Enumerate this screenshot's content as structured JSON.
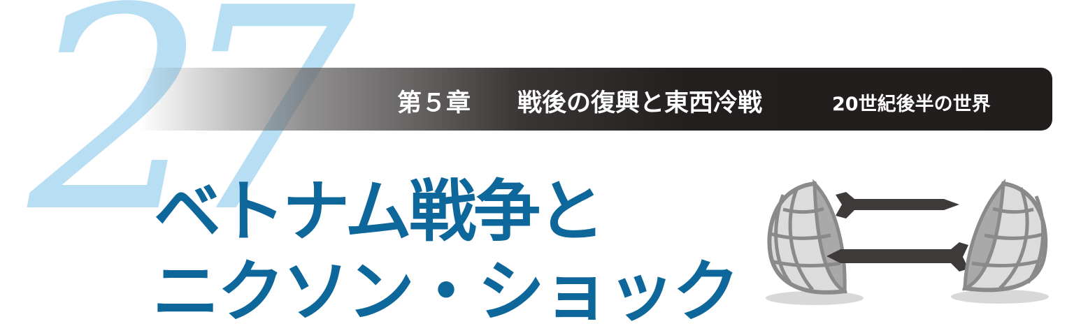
{
  "chapter_number": "27",
  "banner": {
    "chapter_label": "第５章",
    "section_title": "戦後の復興と東西冷戦",
    "era_label": "20世紀後半の世界"
  },
  "title": {
    "line1": "ベトナム戦争と",
    "line2": "ニクソン・ショック"
  },
  "illustration": {
    "icon": "globes-and-missiles-icon",
    "colors": {
      "globe": "#9a9a9a",
      "missile": "#3e3a3a",
      "shadow": "#d8d8d8"
    }
  },
  "colors": {
    "accent_number": "#b8def4",
    "title": "#0e679b",
    "banner_dark": "#231f1f",
    "banner_text": "#ffffff"
  }
}
